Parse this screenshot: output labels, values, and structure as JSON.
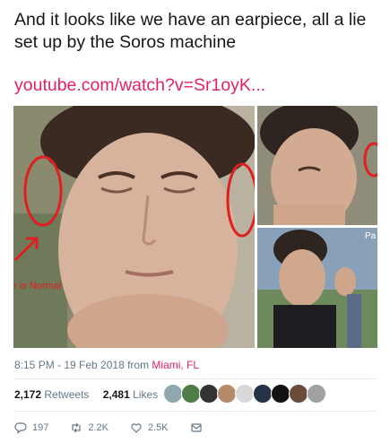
{
  "tweet": {
    "text": "And it looks like we have an earpiece, all a lie set up by the Soros machine",
    "link": "youtube.com/watch?v=Sr1oyK..."
  },
  "media": {
    "overlay_text": "r is Normal",
    "corner_text": "Pa"
  },
  "meta": {
    "time_date": "8:15 PM - 19 Feb 2018 from",
    "location": "Miami, FL"
  },
  "stats": {
    "retweets_count": "2,172",
    "retweets_label": "Retweets",
    "likes_count": "2,481",
    "likes_label": "Likes"
  },
  "actions": {
    "reply": "197",
    "retweet": "2.2K",
    "like": "2.5K"
  },
  "colors": {
    "accent": "#e0245e",
    "muted": "#657786",
    "text": "#14171a"
  }
}
